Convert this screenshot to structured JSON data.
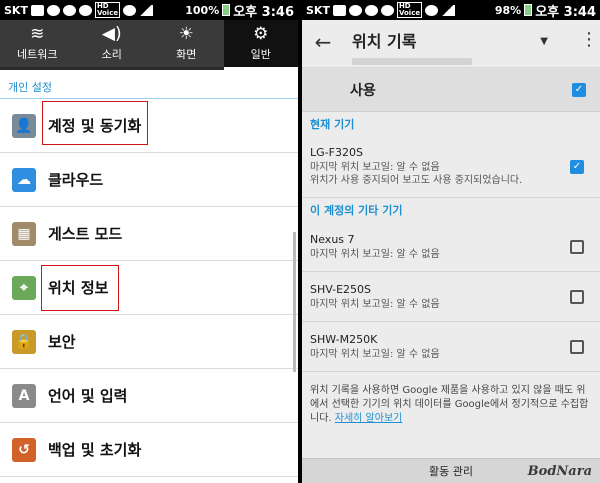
{
  "left": {
    "status": {
      "carrier": "SKT",
      "battery": "100%",
      "time": "오후 3:46"
    },
    "tabs": [
      {
        "label": "네트워크",
        "icon": "wifi-icon",
        "glyph": "≋"
      },
      {
        "label": "소리",
        "icon": "speaker-icon",
        "glyph": "◀)"
      },
      {
        "label": "화면",
        "icon": "brightness-icon",
        "glyph": "☀"
      },
      {
        "label": "일반",
        "icon": "gear-icon",
        "glyph": "⚙"
      }
    ],
    "section_title": "개인 설정",
    "items": [
      {
        "label": "계정 및 동기화",
        "icon": "account-icon",
        "glyph": "👤",
        "color": "#7a8a99"
      },
      {
        "label": "클라우드",
        "icon": "cloud-icon",
        "glyph": "☁",
        "color": "#2e8fe0"
      },
      {
        "label": "게스트 모드",
        "icon": "guest-mode-icon",
        "glyph": "▦",
        "color": "#a08a6a"
      },
      {
        "label": "위치 정보",
        "icon": "location-map-icon",
        "glyph": "⌖",
        "color": "#6aa85a"
      },
      {
        "label": "보안",
        "icon": "lock-icon",
        "glyph": "🔒",
        "color": "#c89a2a"
      },
      {
        "label": "언어 및 입력",
        "icon": "language-icon",
        "glyph": "A",
        "color": "#8a8a8a"
      },
      {
        "label": "백업 및 초기화",
        "icon": "backup-icon",
        "glyph": "↺",
        "color": "#d2622a"
      }
    ]
  },
  "right": {
    "status": {
      "carrier": "SKT",
      "battery": "98%",
      "time": "오후 3:44"
    },
    "appbar": {
      "title": "위치 기록",
      "menu_glyph": "⋮",
      "back_glyph": "←",
      "dropdown_glyph": "▼"
    },
    "master": {
      "label": "사용",
      "checked": true
    },
    "current_device_header": "현재 기기",
    "current_device": {
      "name": "LG-F320S",
      "last_reported": "마지막 위치 보고일: 알 수 없음",
      "note": "위치가 사용 중지되어 보고도 사용 중지되었습니다.",
      "checked": true
    },
    "other_devices_header": "이 계정의 기타 기기",
    "other_devices": [
      {
        "name": "Nexus 7",
        "last_reported": "마지막 위치 보고일: 알 수 없음",
        "checked": false
      },
      {
        "name": "SHV-E250S",
        "last_reported": "마지막 위치 보고일: 알 수 없음",
        "checked": false
      },
      {
        "name": "SHW-M250K",
        "last_reported": "마지막 위치 보고일: 알 수 없음",
        "checked": false
      }
    ],
    "footer_text": "위치 기록을 사용하면 Google 제품을 사용하고 있지 않을 때도 위에서 선택한 기기의 위치 데이터를 Google에서 정기적으로 수집합니다.",
    "footer_link": "자세히 알아보기",
    "action_button": "활동 관리",
    "watermark": "BodNara",
    "accent_color": "#1f8de0"
  }
}
